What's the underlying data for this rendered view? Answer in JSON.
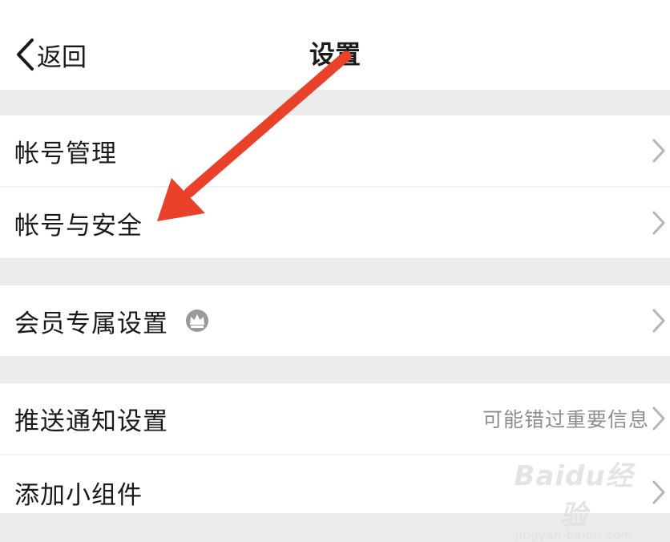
{
  "header": {
    "back_label": "返回",
    "title": "设置"
  },
  "sections": [
    {
      "items": [
        {
          "label": "帐号管理"
        },
        {
          "label": "帐号与安全"
        }
      ]
    },
    {
      "items": [
        {
          "label": "会员专属设置",
          "icon": "crown-icon"
        }
      ]
    },
    {
      "items": [
        {
          "label": "推送通知设置",
          "hint": "可能错过重要信息"
        },
        {
          "label": "添加小组件"
        }
      ]
    }
  ],
  "annotation": {
    "color": "#e9412a",
    "icon": "red-arrow"
  },
  "watermark": {
    "logo": "Baidu经验",
    "url": "jingyan.baidu.com"
  }
}
